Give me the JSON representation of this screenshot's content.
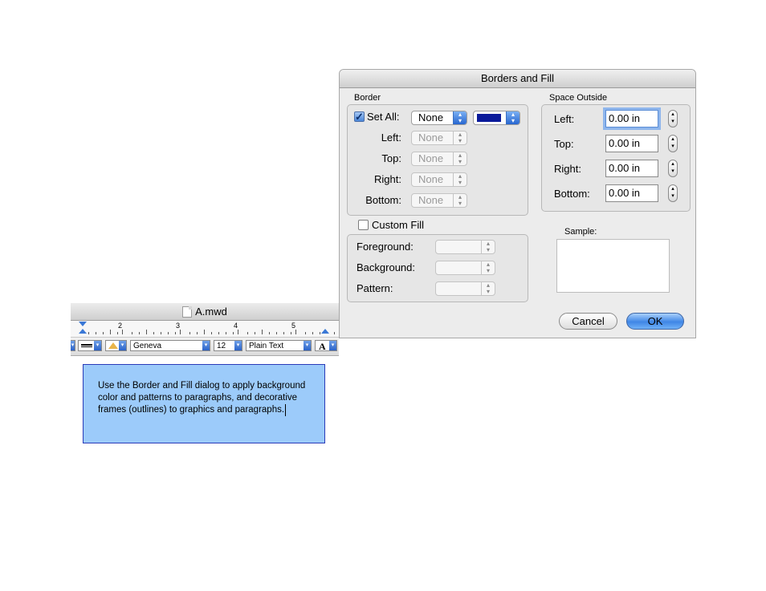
{
  "document_window": {
    "title": "A.mwd",
    "ruler": {
      "numbers": [
        "2",
        "3",
        "4",
        "5"
      ]
    },
    "toolbar": {
      "font": "Geneva",
      "size": "12",
      "style": "Plain Text",
      "text_style_glyph": "A"
    }
  },
  "text_frame": {
    "text": "Use the Border and Fill dialog to apply background color and patterns to paragraphs, and decorative frames (outlines) to graphics and paragraphs.",
    "fill_color": "#9ccbfa",
    "border_color": "#2a3bb8"
  },
  "dialog": {
    "title": "Borders and Fill",
    "border_group": {
      "label": "Border",
      "set_all": {
        "label": "Set All:",
        "checked": true,
        "value": "None",
        "color": "#0a1a9a"
      },
      "rows": [
        {
          "label": "Left:",
          "value": "None"
        },
        {
          "label": "Top:",
          "value": "None"
        },
        {
          "label": "Right:",
          "value": "None"
        },
        {
          "label": "Bottom:",
          "value": "None"
        }
      ]
    },
    "space_outside": {
      "label": "Space Outside",
      "rows": [
        {
          "label": "Left:",
          "value": "0.00 in"
        },
        {
          "label": "Top:",
          "value": "0.00 in"
        },
        {
          "label": "Right:",
          "value": "0.00 in"
        },
        {
          "label": "Bottom:",
          "value": "0.00 in"
        }
      ]
    },
    "custom_fill": {
      "label": "Custom Fill",
      "checked": false,
      "rows": [
        {
          "label": "Foreground:"
        },
        {
          "label": "Background:"
        },
        {
          "label": "Pattern:"
        }
      ]
    },
    "sample_label": "Sample:",
    "cancel_label": "Cancel",
    "ok_label": "OK"
  }
}
